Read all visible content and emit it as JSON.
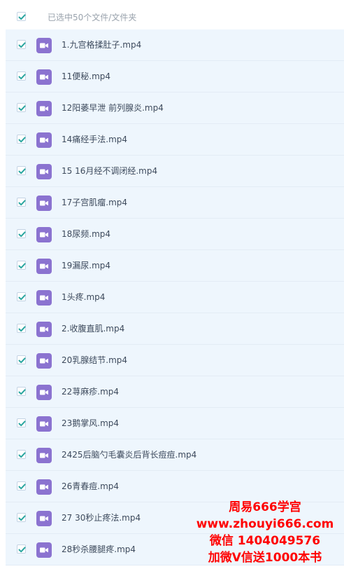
{
  "header": {
    "selected_text": "已选中50个文件/文件夹"
  },
  "files": [
    {
      "name": "1.九宫格揉肚子.mp4",
      "icon": "video-file-icon"
    },
    {
      "name": "11便秘.mp4",
      "icon": "video-file-icon"
    },
    {
      "name": "12阳萎早泄 前列腺炎.mp4",
      "icon": "video-file-icon"
    },
    {
      "name": "14痛经手法.mp4",
      "icon": "video-file-icon"
    },
    {
      "name": "15 16月经不调闭经.mp4",
      "icon": "video-file-icon"
    },
    {
      "name": "17子宫肌瘤.mp4",
      "icon": "video-file-icon"
    },
    {
      "name": "18尿频.mp4",
      "icon": "video-file-icon"
    },
    {
      "name": "19漏尿.mp4",
      "icon": "video-file-icon"
    },
    {
      "name": "1头疼.mp4",
      "icon": "video-file-icon"
    },
    {
      "name": "2.收腹直肌.mp4",
      "icon": "video-file-icon"
    },
    {
      "name": "20乳腺结节.mp4",
      "icon": "video-file-icon"
    },
    {
      "name": "22荨麻疹.mp4",
      "icon": "video-file-icon"
    },
    {
      "name": "23鹅掌风.mp4",
      "icon": "video-file-icon"
    },
    {
      "name": "2425后脑勺毛囊炎后背长痘痘.mp4",
      "icon": "video-file-icon"
    },
    {
      "name": "26青春痘.mp4",
      "icon": "video-file-icon"
    },
    {
      "name": "27 30秒止疼法.mp4",
      "icon": "video-file-icon"
    },
    {
      "name": "28秒杀腰腿疼.mp4",
      "icon": "video-file-icon"
    }
  ],
  "watermark": {
    "line1": "周易666学宫",
    "line2": "www.zhouyi666.com",
    "line3": "微信 1404049576",
    "line4": "加微V信送1000本书"
  },
  "colors": {
    "check": "#2aa6a0",
    "row_bg": "#eef6fd",
    "icon_bg": "#8b73d0",
    "watermark": "#ff0000"
  }
}
